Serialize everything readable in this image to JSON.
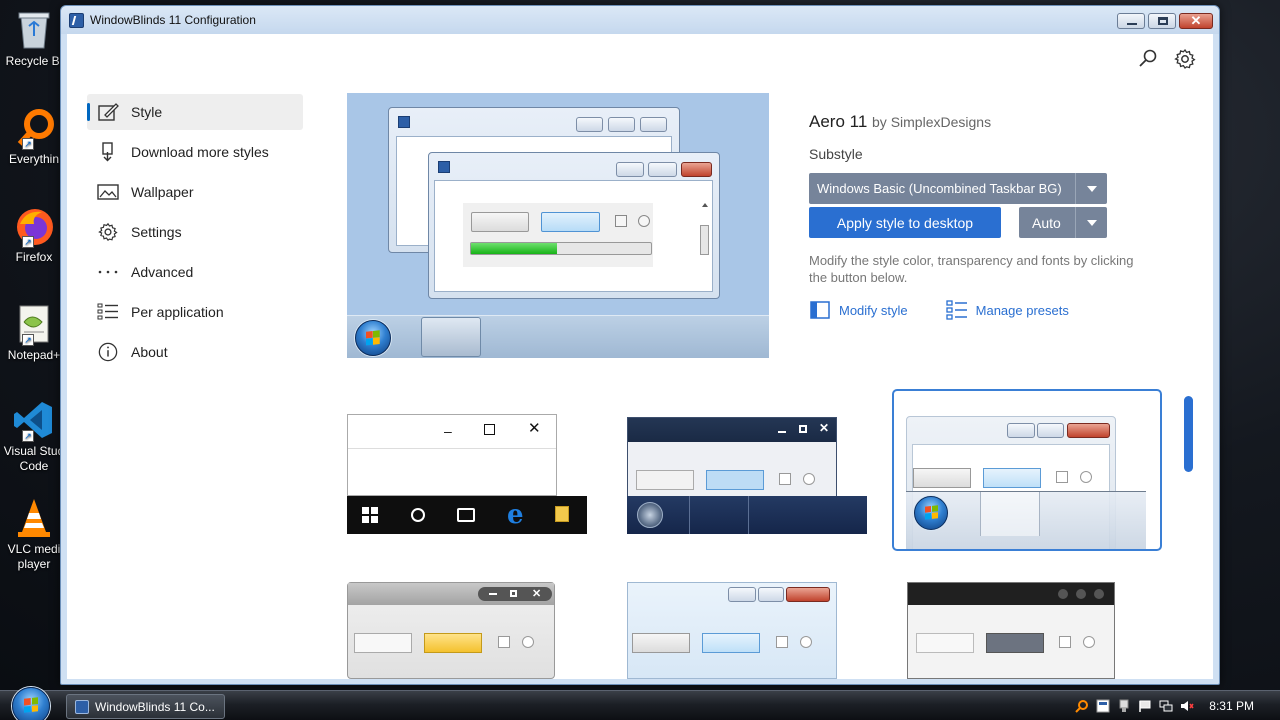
{
  "window": {
    "title": "WindowBlinds 11 Configuration"
  },
  "toolbar": {
    "search_icon": "search-icon",
    "settings_icon": "gear-icon"
  },
  "sidebar": {
    "items": [
      {
        "label": "Style",
        "icon": "paintbrush-icon",
        "active": true
      },
      {
        "label": "Download more styles",
        "icon": "download-icon"
      },
      {
        "label": "Wallpaper",
        "icon": "image-icon"
      },
      {
        "label": "Settings",
        "icon": "gear-icon"
      },
      {
        "label": "Advanced",
        "icon": "ellipsis-icon"
      },
      {
        "label": "Per application",
        "icon": "list-icon"
      },
      {
        "label": "About",
        "icon": "info-icon"
      }
    ]
  },
  "details": {
    "style_name": "Aero 11",
    "style_author": "by SimplexDesigns",
    "substyle_label": "Substyle",
    "substyle_value": "Windows Basic (Uncombined Taskbar BG)",
    "apply_button": "Apply style to desktop",
    "auto_button": "Auto",
    "description": "Modify the style color, transparency and fonts by clicking the button below.",
    "modify_link": "Modify style",
    "presets_link": "Manage presets"
  },
  "desktop": {
    "icons": [
      {
        "label": "Recycle Bi"
      },
      {
        "label": "Everythin"
      },
      {
        "label": "Firefox"
      },
      {
        "label": "Notepad+"
      },
      {
        "label": "Visual Stud Code"
      },
      {
        "label": "VLC medi player"
      }
    ]
  },
  "taskbar": {
    "app_label": "WindowBlinds 11 Co...",
    "clock": "8:31 PM"
  },
  "colors": {
    "accent": "#2a6fd1",
    "selected_border": "#3a7fd5",
    "dropdown_bg": "#76849a"
  }
}
